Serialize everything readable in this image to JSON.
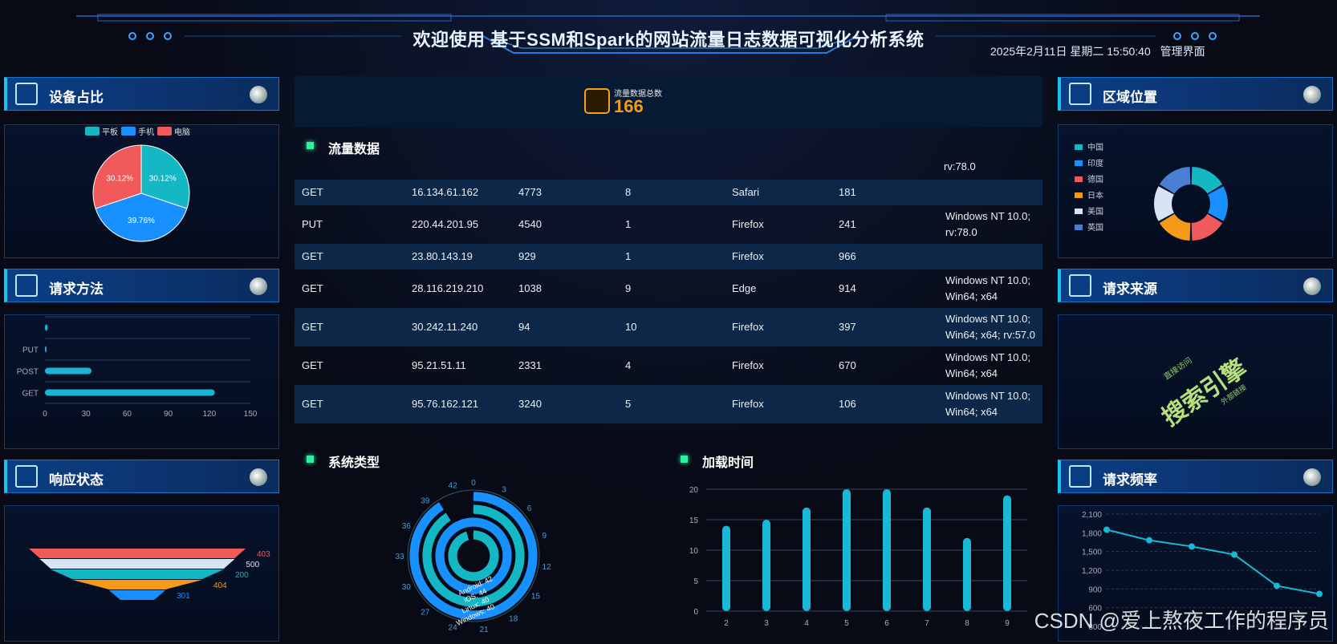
{
  "header": {
    "title": "欢迎使用 基于SSM和Spark的网站流量日志数据可视化分析系统",
    "datetime": "2025年2月11日 星期二 15:50:40",
    "admin_link": "管理界面"
  },
  "panels": {
    "device": "设备占比",
    "method": "请求方法",
    "status": "响应状态",
    "region": "区域位置",
    "source": "请求来源",
    "frequency": "请求频率"
  },
  "kpi": {
    "label": "流量数据总数",
    "value": "166"
  },
  "sections": {
    "traffic": "流量数据",
    "os": "系统类型",
    "load": "加载时间"
  },
  "traffic_table": {
    "top_partial": "rv:78.0",
    "rows": [
      [
        "GET",
        "16.134.61.162",
        "4773",
        "8",
        "Safari",
        "181",
        ""
      ],
      [
        "PUT",
        "220.44.201.95",
        "4540",
        "1",
        "Firefox",
        "241",
        "Windows NT 10.0; rv:78.0"
      ],
      [
        "GET",
        "23.80.143.19",
        "929",
        "1",
        "Firefox",
        "966",
        ""
      ],
      [
        "GET",
        "28.116.219.210",
        "1038",
        "9",
        "Edge",
        "914",
        "Windows NT 10.0; Win64; x64"
      ],
      [
        "GET",
        "30.242.11.240",
        "94",
        "10",
        "Firefox",
        "397",
        "Windows NT 10.0; Win64; x64; rv:57.0"
      ],
      [
        "GET",
        "95.21.51.11",
        "2331",
        "4",
        "Firefox",
        "670",
        "Windows NT 10.0; Win64; x64"
      ],
      [
        "GET",
        "95.76.162.121",
        "3240",
        "5",
        "Firefox",
        "106",
        "Windows NT 10.0; Win64; x64"
      ]
    ]
  },
  "wordcloud": {
    "big": "搜索引擎",
    "small1": "直接访问",
    "small2": "外部链接"
  },
  "watermark": "CSDN @爱上熬夜工作的程序员",
  "colors": {
    "accent": "#18c3f0",
    "kpi": "#f39a19",
    "teal": "#14b8c4",
    "blue": "#1890ff",
    "red": "#f05a5a"
  },
  "chart_data": [
    {
      "type": "pie",
      "legend": [
        "平板",
        "手机",
        "电脑"
      ],
      "values": [
        30.12,
        39.76,
        30.12
      ],
      "labels": [
        "30.12%",
        "39.76%",
        "30.12%"
      ],
      "colors": [
        "#14b8c4",
        "#1890ff",
        "#f05a5a"
      ]
    },
    {
      "type": "bar",
      "orientation": "horizontal",
      "categories": [
        "GET",
        "POST",
        "PUT",
        ""
      ],
      "values": [
        124,
        34,
        1,
        2
      ],
      "xlim": [
        0,
        150
      ],
      "xticks": [
        "0",
        "30",
        "60",
        "90",
        "120",
        "150"
      ]
    },
    {
      "type": "funnel",
      "labels": [
        "403",
        "500",
        "200",
        "404",
        "301"
      ],
      "values": [
        5,
        4.5,
        4,
        3,
        1.3
      ],
      "colors": [
        "#f05a5a",
        "#d6e4f5",
        "#14b8c4",
        "#f39a19",
        "#1890ff"
      ]
    },
    {
      "type": "pie",
      "subtype": "donut",
      "legend": [
        "中国",
        "印度",
        "德国",
        "日本",
        "美国",
        "英国"
      ],
      "values": [
        1,
        1,
        1,
        1,
        1,
        1
      ],
      "colors": [
        "#14b8c4",
        "#1890ff",
        "#f05a5a",
        "#f39a19",
        "#d6e4f5",
        "#4a7fd4"
      ]
    },
    {
      "type": "bar",
      "subtype": "polar",
      "categories": [
        "Android",
        "iOS",
        "Linux",
        "Windows"
      ],
      "values": [
        42,
        44,
        40,
        40
      ],
      "value_labels": [
        "Android: 42",
        "iOS: 44",
        "Linux: 40",
        "Windows: 40"
      ],
      "angle_ticks": [
        "0",
        "3",
        "6",
        "9",
        "12",
        "15",
        "18",
        "21",
        "24",
        "27",
        "30",
        "33",
        "36",
        "39",
        "42"
      ]
    },
    {
      "type": "bar",
      "categories": [
        "2",
        "3",
        "4",
        "5",
        "6",
        "7",
        "8",
        "9"
      ],
      "values": [
        14,
        15,
        17,
        20,
        20,
        17,
        12,
        19
      ],
      "ylim": [
        0,
        20
      ],
      "yticks": [
        "0",
        "5",
        "10",
        "15",
        "20"
      ]
    },
    {
      "type": "line",
      "values": [
        1850,
        1680,
        1580,
        1450,
        950,
        820
      ],
      "ylim": [
        300,
        2100
      ],
      "yticks": [
        "300",
        "600",
        "900",
        "1,200",
        "1,500",
        "1,800",
        "2,100"
      ]
    }
  ]
}
